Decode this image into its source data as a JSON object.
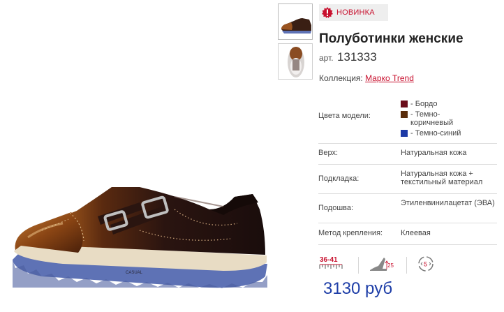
{
  "product": {
    "badge": "НОВИНКА",
    "title": "Полуботинки женские",
    "sku_label": "арт.",
    "sku": "131333",
    "collection_label": "Коллекция:",
    "collection": "Марко Trend",
    "price": "3130 руб"
  },
  "specs": {
    "colors_label": "Цвета модели:",
    "colors": [
      {
        "name": "- Бордо",
        "hex": "#6b0d1a"
      },
      {
        "name": "- Темно-коричневый",
        "hex": "#5a2d0c"
      },
      {
        "name": "- Темно-синий",
        "hex": "#1d3aa6"
      }
    ],
    "upper_label": "Верх:",
    "upper": "Натуральная кожа",
    "lining_label": "Подкладка:",
    "lining": "Натуральная кожа + текстильный материал",
    "sole_label": "Подошва:",
    "sole": "Этиленвинилацетат (ЭВА)",
    "fastening_label": "Метод крепления:",
    "fastening": "Клеевая"
  },
  "icons": {
    "size_range": "36-41",
    "heel_height": "25",
    "warranty": "5"
  },
  "image": {
    "brand_mark": "CASUAL"
  },
  "colors": {
    "accent": "#c8102e",
    "price": "#1f3fa8"
  }
}
